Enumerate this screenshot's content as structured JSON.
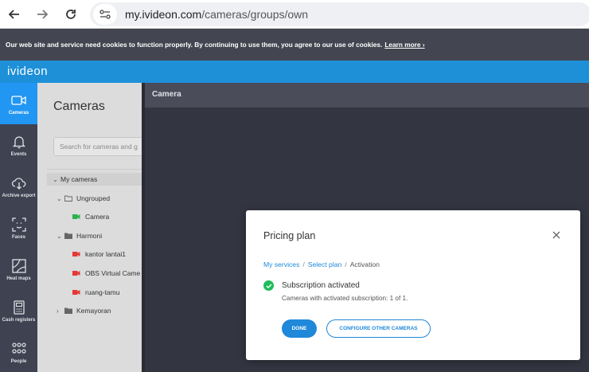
{
  "browser": {
    "url_domain": "my.ivideon.com",
    "url_path": "/cameras/groups/own"
  },
  "cookie_banner": {
    "text": "Our web site and service need cookies to function properly. By continuing to use them, you agree to our use of cookies.",
    "link": "Learn more ›"
  },
  "app": {
    "logo": "ivideon",
    "accent": "#1e90d8"
  },
  "sidebar": {
    "items": [
      {
        "label": "Cameras",
        "icon": "camera-icon"
      },
      {
        "label": "Events",
        "icon": "bell-icon"
      },
      {
        "label": "Archive export",
        "icon": "cloud-download-icon"
      },
      {
        "label": "Faces",
        "icon": "face-icon"
      },
      {
        "label": "Heat maps",
        "icon": "heatmap-icon"
      },
      {
        "label": "Cash registers",
        "icon": "cash-register-icon"
      },
      {
        "label": "People",
        "icon": "people-icon"
      }
    ]
  },
  "panel": {
    "title": "Cameras",
    "search_placeholder": "Search for cameras and g",
    "tree": [
      {
        "label": "My cameras"
      },
      {
        "label": "Ungrouped"
      },
      {
        "label": "Camera"
      },
      {
        "label": "Harmoni"
      },
      {
        "label": "kantor lantai1"
      },
      {
        "label": "OBS Virtual Came"
      },
      {
        "label": "ruang-tamu"
      },
      {
        "label": "Kemayoran"
      }
    ]
  },
  "main": {
    "header": "Camera"
  },
  "modal": {
    "title": "Pricing plan",
    "breadcrumb": {
      "step1": "My services",
      "step2": "Select plan",
      "step3": "Activation"
    },
    "status_title": "Subscription activated",
    "status_sub": "Cameras with activated subscription: 1 of 1.",
    "done_label": "DONE",
    "configure_label": "CONFIGURE OTHER CAMERAS"
  }
}
